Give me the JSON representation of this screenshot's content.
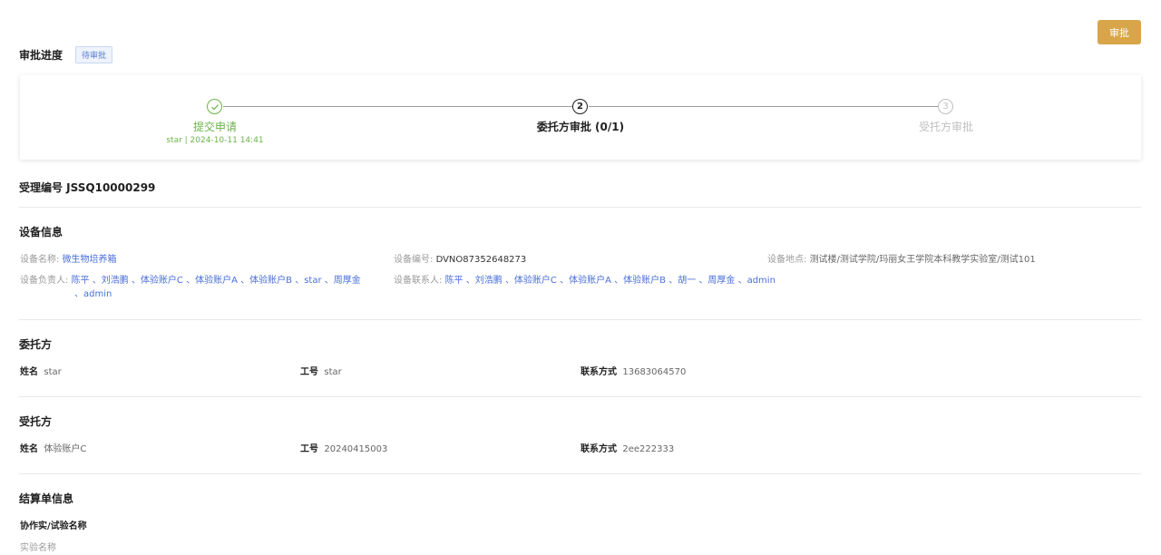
{
  "header": {
    "approve_label": "审批",
    "progress_title": "审批进度",
    "status_badge": "待审批"
  },
  "steps": [
    {
      "number": "",
      "title": "提交申请",
      "sub": "star | 2024-10-11 14:41",
      "state": "done"
    },
    {
      "number": "2",
      "title": "委托方审批 (0/1)",
      "sub": "",
      "state": "active"
    },
    {
      "number": "3",
      "title": "受托方审批",
      "sub": "",
      "state": "pending"
    }
  ],
  "accept_no": "受理编号 JSSQ10000299",
  "device": {
    "title": "设备信息",
    "name_label": "设备名称:",
    "name_value": "微生物培养箱",
    "code_label": "设备编号:",
    "code_value": "DVNO87352648273",
    "location_label": "设备地点:",
    "location_value": "测试楼/测试学院/玛丽女王学院本科教学实验室/测试101",
    "owner_label": "设备负责人:",
    "owners_line1": [
      "陈平",
      "、刘浩鹏",
      "、体验账户C",
      "、体验账户A",
      "、体验账户B",
      "、star",
      "、周厚金"
    ],
    "owners_line2": [
      "、admin"
    ],
    "contact_label": "设备联系人:",
    "contacts": [
      "陈平",
      "、刘浩鹏",
      "、体验账户C",
      "、体验账户A",
      "、体验账户B",
      "、胡一",
      "、周厚金",
      "、admin"
    ]
  },
  "client": {
    "title": "委托方",
    "name_label": "姓名",
    "name_value": "star",
    "id_label": "工号",
    "id_value": "star",
    "phone_label": "联系方式",
    "phone_value": "13683064570"
  },
  "trustee": {
    "title": "受托方",
    "name_label": "姓名",
    "name_value": "体验账户C",
    "id_label": "工号",
    "id_value": "20240415003",
    "phone_label": "联系方式",
    "phone_value": "2ee222333"
  },
  "settlement": {
    "title": "结算单信息",
    "sub_title": "协作实/试验名称",
    "exp_label": "实验名称"
  },
  "colors": {
    "accent": "#d9a54a",
    "done": "#6cb34a",
    "link": "#4a6fd8",
    "pending": "#bfbfbf"
  }
}
